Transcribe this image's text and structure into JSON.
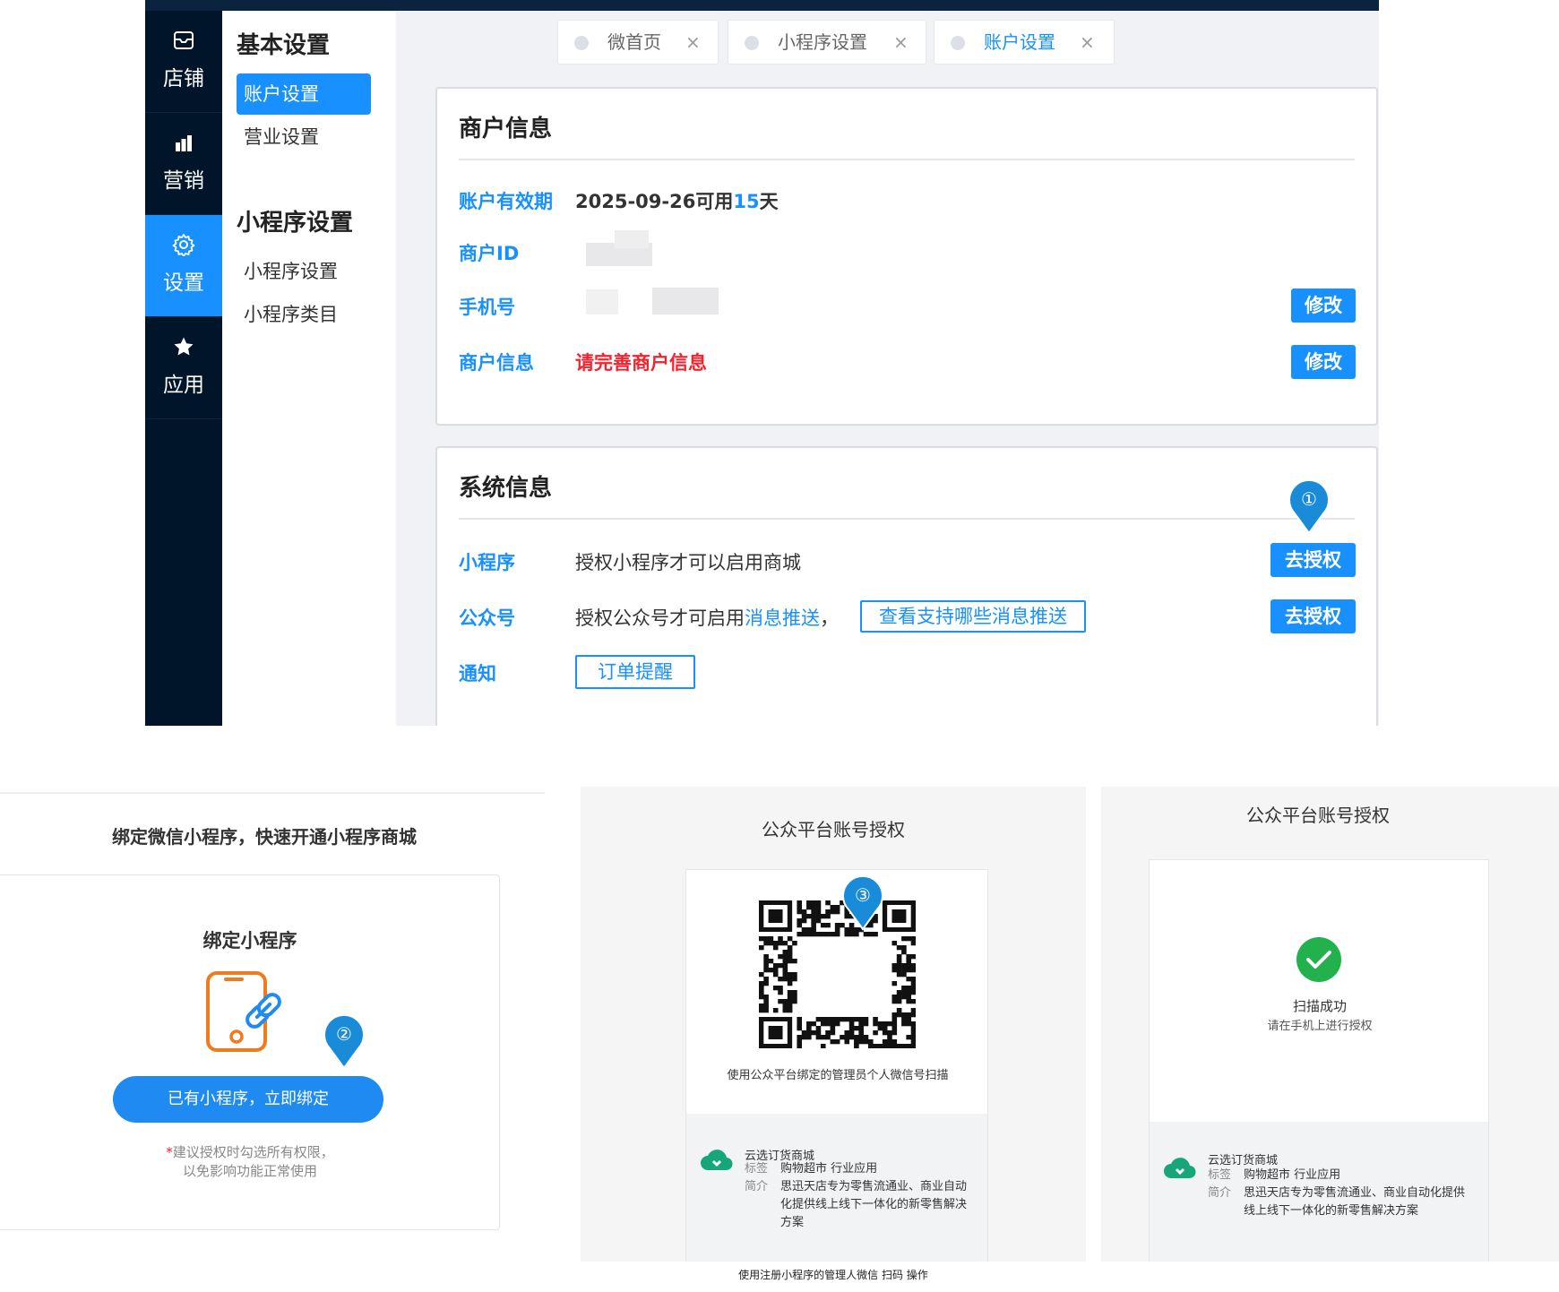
{
  "admin": {
    "nav": [
      {
        "label": "店铺",
        "icon": "store-icon"
      },
      {
        "label": "营销",
        "icon": "bar-chart-icon"
      },
      {
        "label": "设置",
        "icon": "gear-icon",
        "active": true
      },
      {
        "label": "应用",
        "icon": "star-icon"
      }
    ],
    "subnav": {
      "group1": "基本设置",
      "group1_items": [
        "账户设置",
        "营业设置"
      ],
      "group2": "小程序设置",
      "group2_items": [
        "小程序设置",
        "小程序类目"
      ]
    },
    "tabs": [
      {
        "label": "微首页",
        "close": "×"
      },
      {
        "label": "小程序设置",
        "close": "×"
      },
      {
        "label": "账户设置",
        "close": "×",
        "active": true
      }
    ],
    "merchant": {
      "title": "商户信息",
      "validity_label": "账户有效期",
      "validity_date": "2025-09-26可用",
      "validity_days": "15",
      "validity_unit": "天",
      "id_label": "商户ID",
      "phone_label": "手机号",
      "info_label": "商户信息",
      "info_value": "请完善商户信息",
      "edit_label": "修改"
    },
    "system": {
      "title": "系统信息",
      "mini_label": "小程序",
      "mini_text": "授权小程序才可以启用商城",
      "oa_label": "公众号",
      "oa_text": "授权公众号才可启用",
      "oa_link": "消息推送",
      "oa_comma": "，",
      "oa_button": "查看支持哪些消息推送",
      "notice_label": "通知",
      "notice_button": "订单提醒",
      "auth_button": "去授权"
    }
  },
  "markers": [
    "①",
    "②",
    "③"
  ],
  "bind_panel": {
    "heading": "绑定微信小程序，快速开通小程序商城",
    "title": "绑定小程序",
    "button": "已有小程序，立即绑定",
    "note_star": "*",
    "note_line1": "建议授权时勾选所有权限，",
    "note_line2": "以免影响功能正常使用"
  },
  "qr_panel": {
    "title": "公众平台账号授权",
    "hint": "使用公众平台绑定的管理员个人微信号扫描"
  },
  "success_panel": {
    "title": "公众平台账号授权",
    "status": "扫描成功",
    "sub": "请在手机上进行授权"
  },
  "app": {
    "name": "云选订货商城",
    "tag_key": "标签",
    "tag_val": "购物超市 行业应用",
    "desc_key": "简介",
    "desc_val": "思迅天店专为零售流通业、商业自动化提供线上线下一体化的新零售解决方案"
  },
  "caption": "使用注册小程序的管理人微信 扫码 操作",
  "colors": {
    "primary": "#1890ff",
    "sidebar": "#001529",
    "danger": "#f5222d",
    "success": "#23b14d"
  }
}
